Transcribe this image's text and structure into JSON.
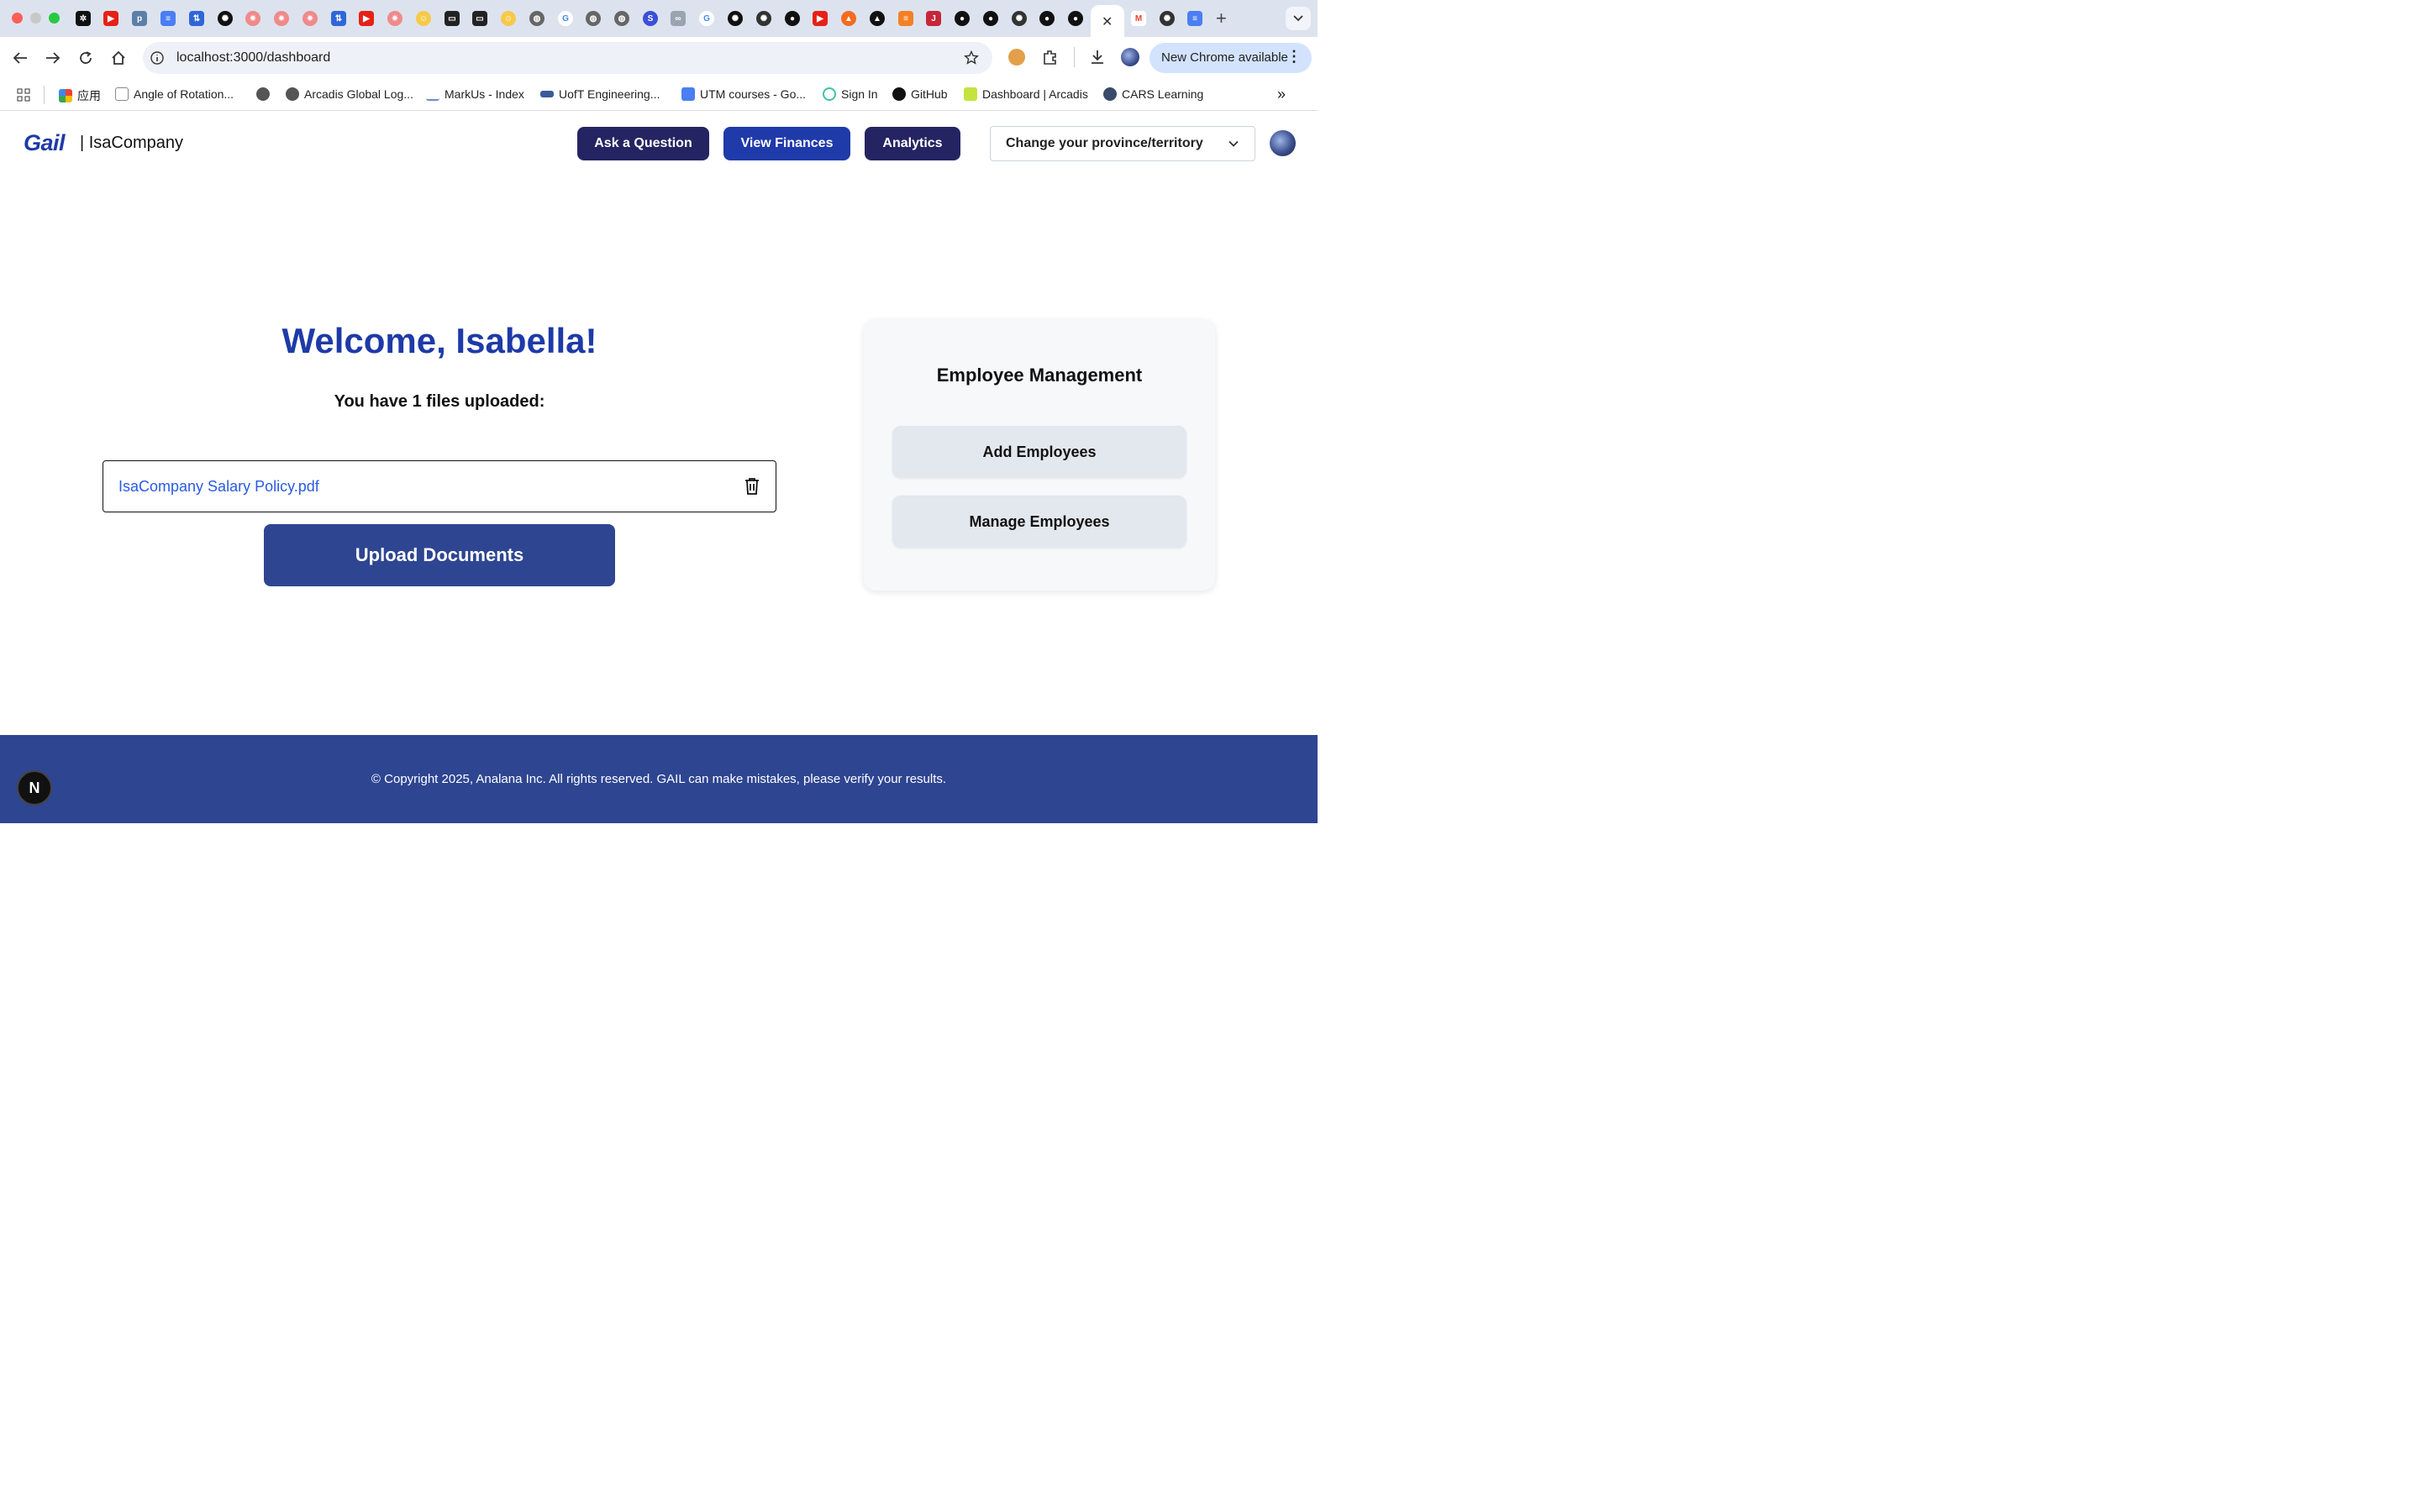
{
  "browser": {
    "url": "localhost:3000/dashboard",
    "update_label": "New Chrome available",
    "update_dots": "⋮",
    "new_tab": "+",
    "close_tab": "✕"
  },
  "bookmarks": [
    {
      "label": "应用"
    },
    {
      "label": "Angle of Rotation..."
    },
    {
      "label": "Arcadis Global Log..."
    },
    {
      "label": "MarkUs - Index"
    },
    {
      "label": "UofT Engineering..."
    },
    {
      "label": "UTM courses - Go..."
    },
    {
      "label": "Sign In"
    },
    {
      "label": "GitHub"
    },
    {
      "label": "Dashboard | Arcadis"
    },
    {
      "label": "CARS Learning"
    }
  ],
  "bookmarks_more": "»",
  "header": {
    "logo": "Gail",
    "company": "| IsaCompany",
    "ask_label": "Ask a Question",
    "finances_label": "View Finances",
    "analytics_label": "Analytics",
    "province_label": "Change your province/territory"
  },
  "main": {
    "welcome": "Welcome, Isabella!",
    "files_count": "You have 1 files uploaded:",
    "files": [
      {
        "name": "IsaCompany Salary Policy.pdf"
      }
    ],
    "upload_label": "Upload Documents"
  },
  "employee": {
    "title": "Employee Management",
    "add_label": "Add Employees",
    "manage_label": "Manage Employees"
  },
  "footer": {
    "text": "© Copyright 2025, Analana Inc. All rights reserved. GAIL can make mistakes, please verify your results."
  },
  "dev_badge": "N",
  "colors": {
    "brand_blue": "#1e3aa8",
    "navy": "#252462",
    "footer": "#2e4591",
    "link": "#2a5be0"
  }
}
